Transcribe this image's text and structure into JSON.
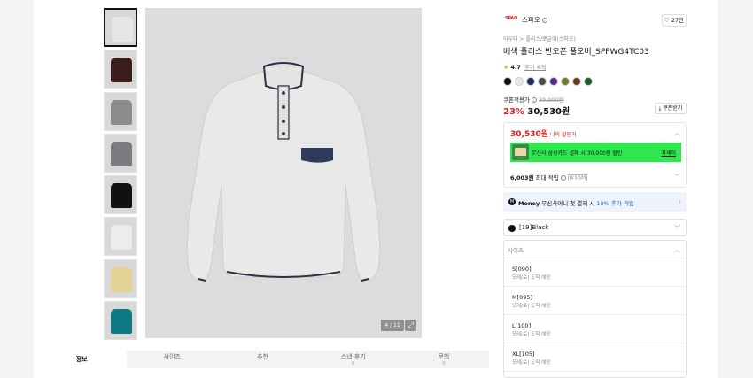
{
  "gallery": {
    "thumb_colors": [
      "#e6e6e4",
      "#3a1d1d",
      "#8c8c8c",
      "#7c7c80",
      "#111111",
      "#ececea",
      "#e4d394",
      "#0f7a84"
    ],
    "counter": "4 / 11",
    "zoom_icon": "expand-icon"
  },
  "tabs": [
    {
      "label": "정보",
      "count": ""
    },
    {
      "label": "사이즈",
      "count": ""
    },
    {
      "label": "추천",
      "count": ""
    },
    {
      "label": "스냅·후기",
      "count": "6"
    },
    {
      "label": "문의",
      "count": "0"
    }
  ],
  "brand": {
    "logo_text": "SPAO",
    "name": "스파오",
    "like_count": "27만"
  },
  "product": {
    "breadcrumb": "아우터 > 플리스/뽀글이(스파오)",
    "title": "배색 플리스 반오픈 풀오버_SPFWG4TC03",
    "rating": "4.7",
    "reviews": "후기 6개",
    "swatches": [
      "#111111",
      "#e8e8e4",
      "#1f2d5c",
      "#4a4a52",
      "#5a2a8a",
      "#6f7d2c",
      "#6b3a1a",
      "#1d5a2e"
    ],
    "coupon_label": "쿠폰적용가",
    "original_price": "39,900원",
    "discount": "23%",
    "sale_price": "30,530원",
    "coupon_button": "쿠폰받기"
  },
  "benefits": {
    "my_price": "30,530원",
    "my_price_label": "나의 할인가",
    "card_text": "무신사 삼성카드 결제 시 30,000원 할인",
    "card_more": "자세히",
    "points_bold": "6,003원",
    "points_text": "최대 적립",
    "level_badge": "LV.5 실버"
  },
  "money": {
    "icon_label": "M",
    "prefix": "Money",
    "text": "무신사머니 첫 결제 시",
    "highlight": "10% 추가 적립"
  },
  "options": {
    "color_value": "[19]Black",
    "size_header": "사이즈",
    "sizes": [
      {
        "name": "S[090]",
        "note": "모레(토) 도착 예정"
      },
      {
        "name": "M[095]",
        "note": "모레(토) 도착 예정"
      },
      {
        "name": "L[100]",
        "note": "모레(토) 도착 예정"
      },
      {
        "name": "XL[105]",
        "note": "모레(토) 도착 예정"
      }
    ]
  }
}
